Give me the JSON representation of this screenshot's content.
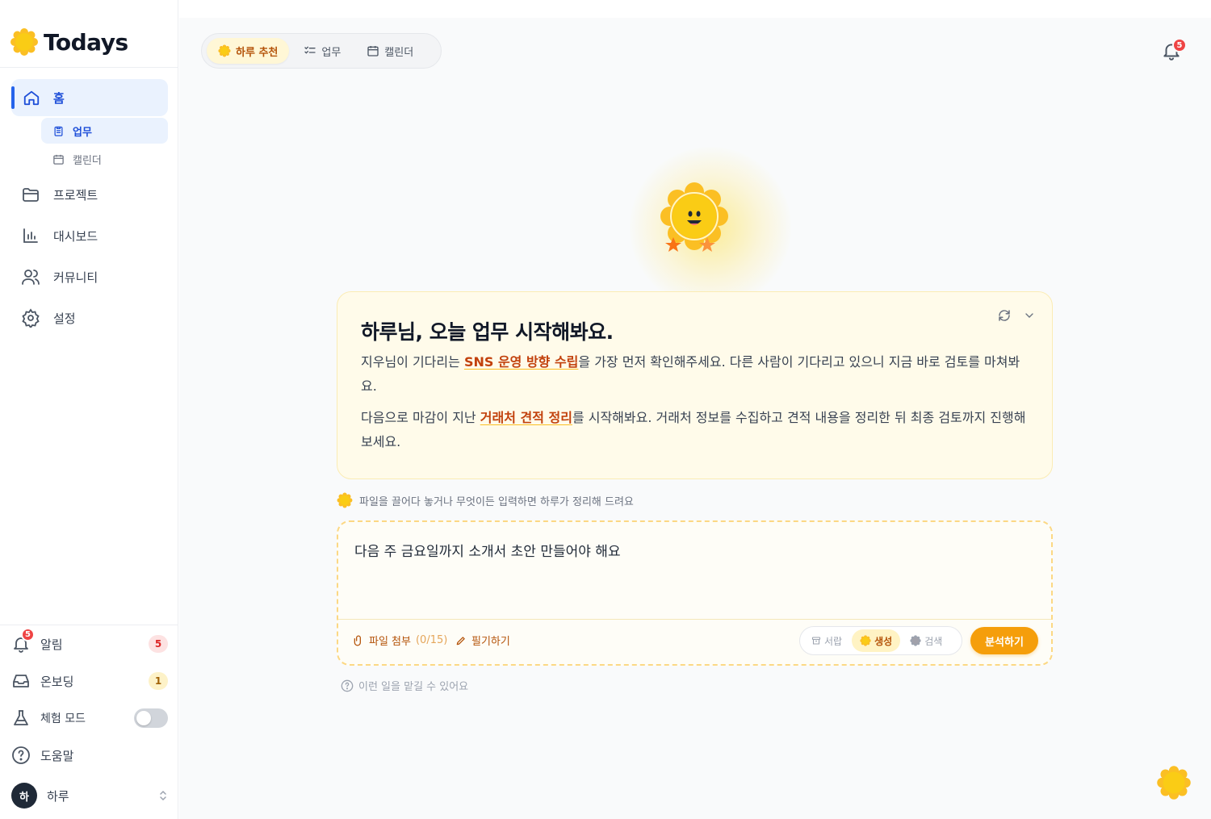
{
  "brand": {
    "name": "Todays"
  },
  "sidebar": {
    "home": "홈",
    "sub_tasks": "업무",
    "sub_calendar": "캘린더",
    "projects": "프로젝트",
    "dashboard": "대시보드",
    "community": "커뮤니티",
    "settings": "설정",
    "notifications": "알림",
    "notifications_count": "5",
    "notifications_dot": "5",
    "onboarding": "온보딩",
    "onboarding_count": "1",
    "trial_mode": "체험 모드",
    "trial_mode_on": false,
    "help": "도움말",
    "user_name": "하루",
    "user_initial": "하"
  },
  "tabs": {
    "recommend": "하루 추천",
    "tasks": "업무",
    "calendar": "캘린더"
  },
  "header": {
    "bell_count": "5"
  },
  "card": {
    "title": "하루님, 오늘 업무 시작해봐요.",
    "p1_before": "지우님이 기다리는 ",
    "p1_highlight": "SNS 운영 방향 수립",
    "p1_after": "을 가장 먼저 확인해주세요. 다른 사람이 기다리고 있으니 지금 바로 검토를 마쳐봐요.",
    "p2_before": "다음으로 마감이 지난 ",
    "p2_highlight": "거래처 견적 정리",
    "p2_after": "를 시작해봐요. 거래처 정보를 수집하고 견적 내용을 정리한 뒤 최종 검토까지 진행해보세요."
  },
  "composer": {
    "hint": "파일을 끌어다 놓거나 무엇이든 입력하면 하루가 정리해 드려요",
    "value": "다음 주 금요일까지 소개서 초안 만들어야 해요",
    "attach_label": "파일 첨부",
    "attach_count": "(0/15)",
    "handwrite_label": "필기하기",
    "modes": [
      "서랍",
      "생성",
      "검색"
    ],
    "active_mode": "생성",
    "analyze_label": "분석하기",
    "help_hint": "이런 일을 맡길 수 있어요"
  },
  "colors": {
    "accent": "#f59e0b",
    "brand_blue": "#2563eb",
    "highlight": "#c2410c"
  }
}
